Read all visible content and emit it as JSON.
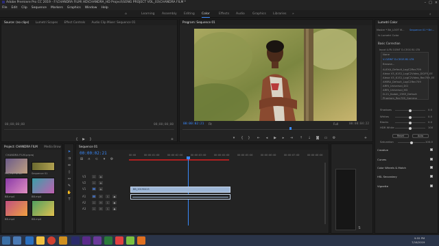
{
  "titlebar": {
    "title": "Adobe Premiere Pro CC 2019 - F:\\CHANDRA FILM\\ HD\\CHANDRA_HD Project\\SONG PROJECT VOL_03\\CHANDRA FILM *"
  },
  "menu": [
    "File",
    "Edit",
    "Clip",
    "Sequence",
    "Markers",
    "Graphics",
    "Window",
    "Help"
  ],
  "workspaces": {
    "items": [
      "Learning",
      "Assembly",
      "Editing",
      "Color",
      "Effects",
      "Audio",
      "Graphics",
      "Libraries"
    ],
    "active": "Color"
  },
  "source_panel": {
    "tabs": [
      "Source: (no clips)",
      "Lumetri Scopes",
      "Effect Controls",
      "Audio Clip Mixer: Sequence 01"
    ],
    "timecode_left": "00;00;00;00",
    "timecode_right": "00;00;00;00"
  },
  "program_panel": {
    "tab": "Program: Sequence 01",
    "timecode_left": "00:00:02:21",
    "fit": "Fit",
    "quality": "Full",
    "timecode_right": "00:00:04:22"
  },
  "lumetri": {
    "tab": "Lumetri Color",
    "master": "Master * Bri_LOOT M...",
    "sequence": "Sequence 01 * Bri...",
    "fx_label": "fx  Lumetri Color",
    "basic_correction": "Basic Correction",
    "input_lut_label": "Input LUT",
    "input_lut_value": "V-OZINT D-CEGS B1 LT8",
    "lut_list": [
      "None",
      "V-OZINT D-CEGS B1 LT8",
      "Browse...",
      "ALEXA_Default_LogC2Rec709",
      "Alexa V3_K1S1_LogC2Video_DCIP3_EE",
      "Alexa V3_K1S1_LogC2Video_Rec709_EE",
      "AMIRA_Default_LogC2Rec709",
      "ARRI_Universal_DCI",
      "ARRI_Universal_HD",
      "D-21_Kodak_2383_Default",
      "Phantom_Rec709_Gamma"
    ],
    "lut_selected_index": 1,
    "sliders": [
      {
        "label": "Shadows",
        "value": "0.0"
      },
      {
        "label": "Whites",
        "value": "0.0"
      },
      {
        "label": "Blacks",
        "value": "0.0"
      },
      {
        "label": "HDR White",
        "value": "100"
      }
    ],
    "reset": "Reset",
    "auto": "Auto",
    "saturation_label": "Saturation",
    "saturation_value": "100.0",
    "sections": [
      "Creative",
      "Curves",
      "Color Wheels & Match",
      "HSL Secondary",
      "Vignette"
    ]
  },
  "project_panel": {
    "tabs": [
      "Project: CHANDRA FILM",
      "Media Brow"
    ],
    "file": "CHANDRA FILM.prproj",
    "items": [
      "MA_EDITBRDE",
      "Sequence 01",
      "BB.mp4",
      "BB.mp4",
      "BB.mp4",
      "BB.mp4"
    ]
  },
  "timeline": {
    "tab": "Sequence 01",
    "timecode": "00:00:02:21",
    "ruler": [
      "00:00",
      "00:00:01:00",
      "00:00:02:00",
      "00:00:03:00",
      "00:00:04:00",
      "00:00:05:00",
      "00:00:06:00",
      "00:00:07:00",
      "00:00:08:00"
    ],
    "tracks": [
      "V3",
      "V2",
      "V1",
      "A1",
      "A2",
      "A3"
    ],
    "clip_label": "BB_20190415"
  },
  "taskbar": {
    "time": "9:55 PM",
    "date": "7/16/2019"
  },
  "colors": {
    "accent": "#3a8bff",
    "panel": "#232323",
    "background": "#1b1b1b",
    "clip": "#9db6d6"
  }
}
